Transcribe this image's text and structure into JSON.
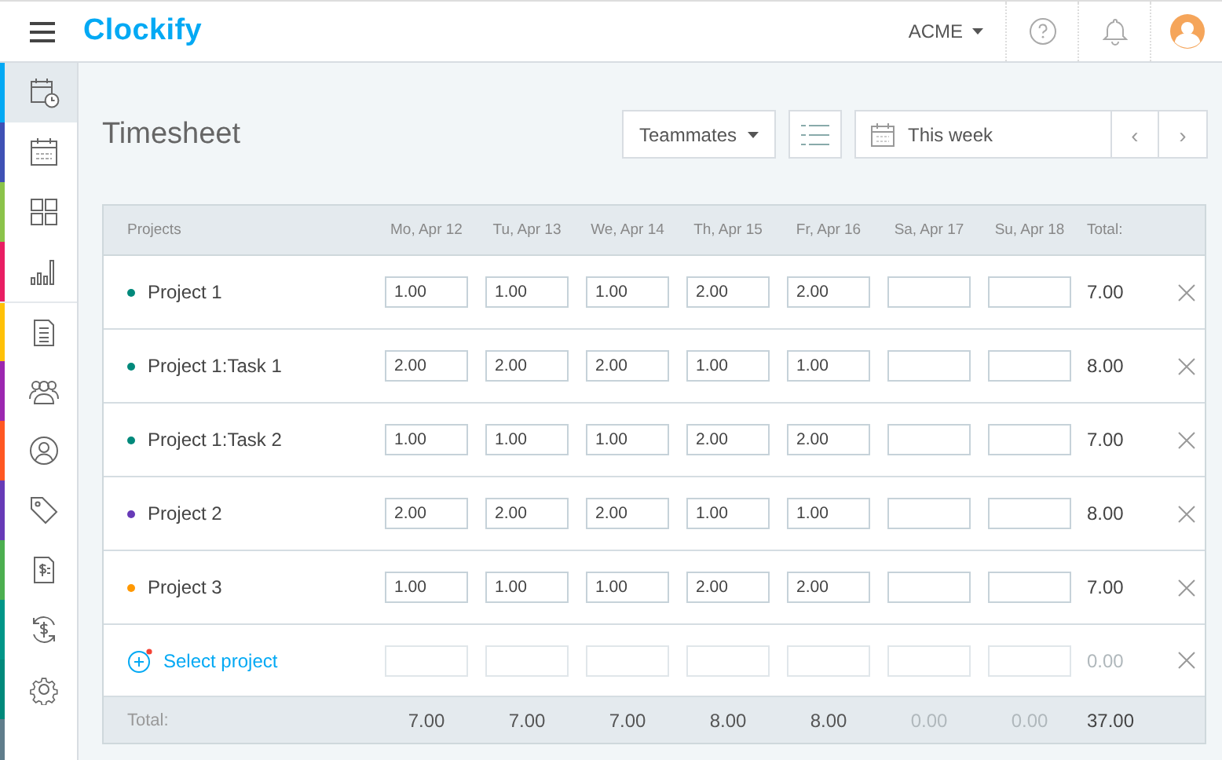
{
  "header": {
    "logo": "Clockify",
    "workspace": "ACME"
  },
  "sidebar": {
    "items": [
      {
        "selected": true,
        "color": "#03a9f4"
      },
      {
        "selected": false,
        "color": "#3f51b5"
      },
      {
        "selected": false,
        "color": "#8bc34a"
      },
      {
        "selected": false,
        "color": "#e91e63"
      },
      {
        "selected": false,
        "color": "#ffc107"
      },
      {
        "selected": false,
        "color": "#9c27b0"
      },
      {
        "selected": false,
        "color": "#ff5722"
      },
      {
        "selected": false,
        "color": "#673ab7"
      },
      {
        "selected": false,
        "color": "#4caf50"
      },
      {
        "selected": false,
        "color": "#009688"
      },
      {
        "selected": false,
        "color": "#00897b"
      }
    ]
  },
  "page": {
    "title": "Timesheet",
    "filter": "Teammates",
    "range": "This week",
    "prev": "‹",
    "next": "›"
  },
  "table": {
    "columns": [
      "Projects",
      "Mo, Apr 12",
      "Tu, Apr 13",
      "We, Apr 14",
      "Th, Apr 15",
      "Fr, Apr 16",
      "Sa, Apr 17",
      "Su, Apr 18",
      "Total:"
    ],
    "rows": [
      {
        "kind": "project",
        "name": "Project 1",
        "color": "#00897b",
        "hours": [
          "1.00",
          "1.00",
          "1.00",
          "2.00",
          "2.00"
        ],
        "total": "7.00",
        "dim": false
      },
      {
        "kind": "project",
        "name": "Project 1:Task 1",
        "color": "#00897b",
        "hours": [
          "2.00",
          "2.00",
          "2.00",
          "1.00",
          "1.00"
        ],
        "total": "8.00",
        "dim": false
      },
      {
        "kind": "project",
        "name": "Project 1:Task 2",
        "color": "#00897b",
        "hours": [
          "1.00",
          "1.00",
          "1.00",
          "2.00",
          "2.00"
        ],
        "total": "7.00",
        "dim": false
      },
      {
        "kind": "project",
        "name": "Project 2",
        "color": "#673ab7",
        "hours": [
          "2.00",
          "2.00",
          "2.00",
          "1.00",
          "1.00"
        ],
        "total": "8.00",
        "dim": false
      },
      {
        "kind": "project",
        "name": "Project 3",
        "color": "#ff9800",
        "hours": [
          "1.00",
          "1.00",
          "1.00",
          "2.00",
          "2.00"
        ],
        "total": "7.00",
        "dim": false
      },
      {
        "kind": "add",
        "name": "Select project",
        "total": "0.00",
        "dim": true
      }
    ],
    "footer": {
      "label": "Total:",
      "totals": [
        {
          "text": "7.00",
          "dim": false
        },
        {
          "text": "7.00",
          "dim": false
        },
        {
          "text": "7.00",
          "dim": false
        },
        {
          "text": "8.00",
          "dim": false
        },
        {
          "text": "8.00",
          "dim": false
        },
        {
          "text": "0.00",
          "dim": true
        },
        {
          "text": "0.00",
          "dim": true
        }
      ],
      "total": {
        "text": "37.00",
        "dim": false
      }
    }
  }
}
